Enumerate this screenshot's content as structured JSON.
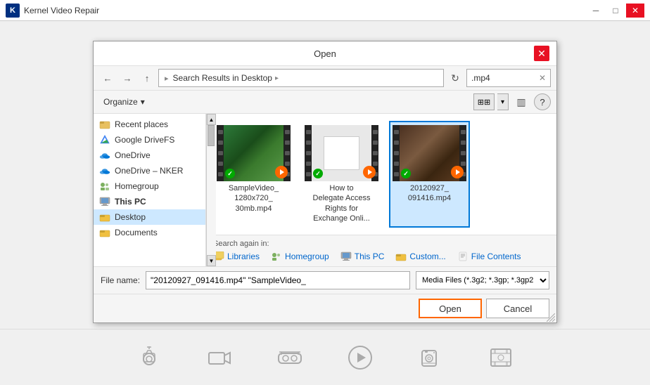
{
  "app": {
    "title": "Kernel Video Repair",
    "icon": "K"
  },
  "dialog": {
    "title": "Open",
    "address": {
      "back_tooltip": "Back",
      "forward_tooltip": "Forward",
      "up_tooltip": "Up",
      "path": "Search Results in Desktop",
      "path_arrow": "▸",
      "search_value": ".mp4",
      "search_clear": "✕"
    },
    "toolbar": {
      "organize_label": "Organize",
      "organize_arrow": "▾",
      "view_icon": "⊞",
      "view_arrow": "▾",
      "layout_icon": "▥",
      "help_icon": "?"
    },
    "sidebar": {
      "items": [
        {
          "id": "recent-places",
          "label": "Recent places",
          "type": "place",
          "icon": "recent"
        },
        {
          "id": "google-drivefs",
          "label": "Google DriveFS",
          "type": "drive",
          "icon": "drive"
        },
        {
          "id": "onedrive",
          "label": "OneDrive",
          "type": "cloud",
          "icon": "cloud"
        },
        {
          "id": "onedrive-nker",
          "label": "OneDrive – NKER",
          "type": "cloud",
          "icon": "cloud"
        },
        {
          "id": "homegroup",
          "label": "Homegroup",
          "type": "group",
          "icon": "group"
        },
        {
          "id": "this-pc",
          "label": "This PC",
          "type": "pc",
          "icon": "pc"
        },
        {
          "id": "desktop",
          "label": "Desktop",
          "type": "folder",
          "icon": "folder",
          "selected": true
        },
        {
          "id": "documents",
          "label": "Documents",
          "type": "folder",
          "icon": "folder"
        }
      ]
    },
    "files": [
      {
        "id": "file-1",
        "name": "SampleVideo_1280x720_30mb.mp4",
        "label": "SampleVideo_\n1280x720_\n30mb.mp4",
        "thumbnail": "video1",
        "selected": false
      },
      {
        "id": "file-2",
        "name": "How to Delegate Access Rights for Exchange Onli...",
        "label": "How to\nDelegate Access\nRights for\nExchange Onli...",
        "thumbnail": "video2",
        "selected": false
      },
      {
        "id": "file-3",
        "name": "20120927_091416.mp4",
        "label": "20120927_\n091416.mp4",
        "thumbnail": "video3",
        "selected": true
      }
    ],
    "search_again": {
      "label": "Search again in:",
      "options": [
        {
          "id": "libraries",
          "label": "Libraries",
          "icon": "📚"
        },
        {
          "id": "homegroup",
          "label": "Homegroup",
          "icon": "🏠"
        },
        {
          "id": "this-pc",
          "label": "This PC",
          "icon": "💻"
        },
        {
          "id": "custom",
          "label": "Custom...",
          "icon": "📁"
        },
        {
          "id": "file-contents",
          "label": "File Contents",
          "icon": "📄"
        }
      ]
    },
    "file_name": {
      "label": "File name:",
      "value": "\"20120927_091416.mp4\" \"SampleVideo_",
      "placeholder": ""
    },
    "file_type": {
      "value": "Media Files (*.3g2; *.3gp; *.3gp2"
    },
    "buttons": {
      "open_label": "Open",
      "cancel_label": "Cancel"
    }
  },
  "bottom_icons": [
    {
      "id": "icon-camera",
      "label": ""
    },
    {
      "id": "icon-video",
      "label": ""
    },
    {
      "id": "icon-vr",
      "label": ""
    },
    {
      "id": "icon-play",
      "label": ""
    },
    {
      "id": "icon-cam2",
      "label": ""
    },
    {
      "id": "icon-film",
      "label": ""
    }
  ]
}
